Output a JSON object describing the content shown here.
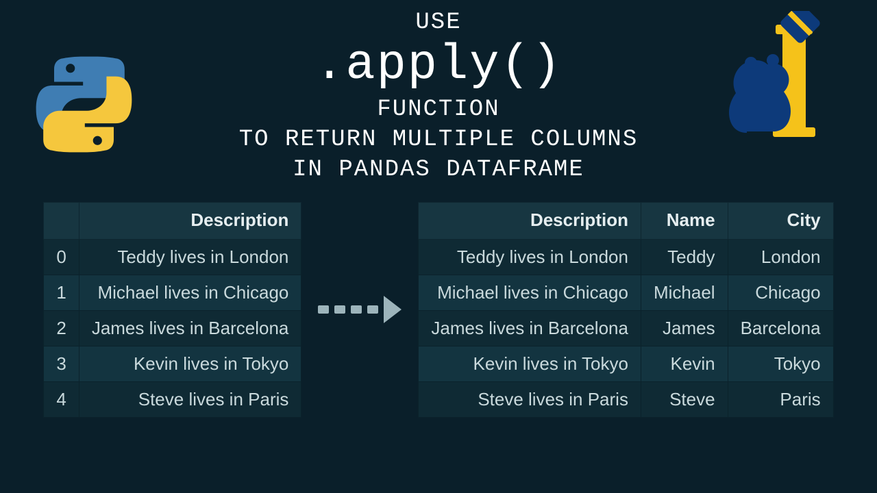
{
  "title": {
    "line1": "USE",
    "line2": ".apply()",
    "line3": "FUNCTION",
    "line4": "TO RETURN MULTIPLE COLUMNS",
    "line5": "IN PANDAS DATAFRAME"
  },
  "left_table": {
    "headers": [
      "",
      "Description"
    ],
    "rows": [
      {
        "idx": "0",
        "desc": "Teddy lives in London"
      },
      {
        "idx": "1",
        "desc": "Michael lives in Chicago"
      },
      {
        "idx": "2",
        "desc": "James lives in Barcelona"
      },
      {
        "idx": "3",
        "desc": "Kevin lives in Tokyo"
      },
      {
        "idx": "4",
        "desc": "Steve lives in Paris"
      }
    ]
  },
  "right_table": {
    "headers": [
      "Description",
      "Name",
      "City"
    ],
    "rows": [
      {
        "desc": "Teddy lives in London",
        "name": "Teddy",
        "city": "London"
      },
      {
        "desc": "Michael lives in Chicago",
        "name": "Michael",
        "city": "Chicago"
      },
      {
        "desc": "James lives in Barcelona",
        "name": "James",
        "city": "Barcelona"
      },
      {
        "desc": "Kevin lives in Tokyo",
        "name": "Kevin",
        "city": "Tokyo"
      },
      {
        "desc": "Steve lives in Paris",
        "name": "Steve",
        "city": "Paris"
      }
    ]
  }
}
